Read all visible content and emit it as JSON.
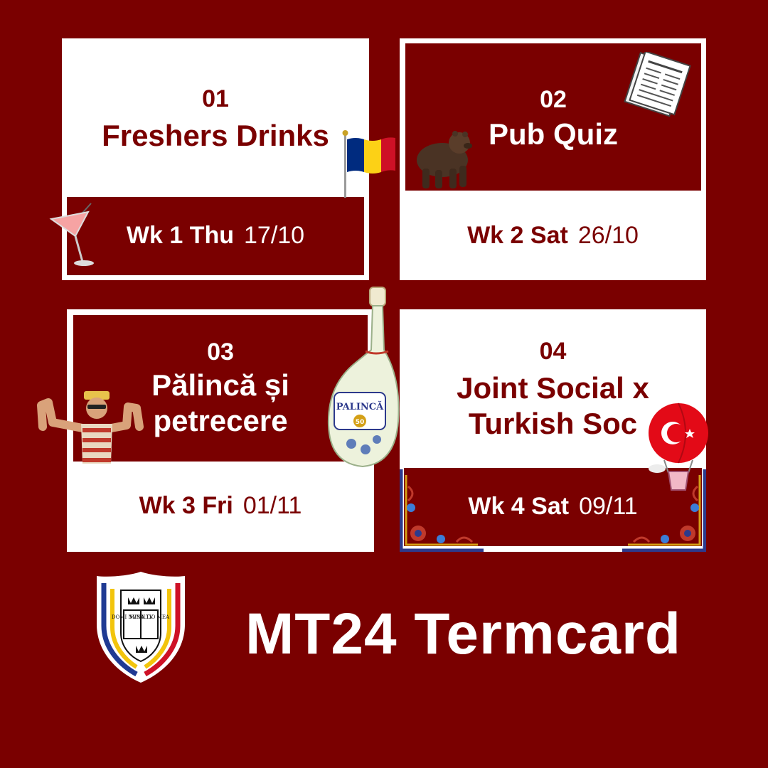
{
  "events": [
    {
      "number": "01",
      "title": "Freshers Drinks",
      "week": "Wk 1 Thu",
      "date": "17/10"
    },
    {
      "number": "02",
      "title": "Pub Quiz",
      "week": "Wk 2 Sat",
      "date": "26/10"
    },
    {
      "number": "03",
      "title_line1": "Pălincă și",
      "title_line2": "petrecere",
      "week": "Wk 3 Fri",
      "date": "01/11"
    },
    {
      "number": "04",
      "title_line1": "Joint Social x",
      "title_line2": "Turkish Soc",
      "week": "Wk 4 Sat",
      "date": "09/11"
    }
  ],
  "footer": {
    "title": "MT24 Termcard"
  },
  "crest": {
    "text_tl": "DOMI NVS ILLV",
    "text_tr": "MINA TIO MEA"
  },
  "bottle": {
    "label": "PALINCĂ",
    "badge": "50"
  },
  "icons": [
    "cocktail-icon",
    "romania-flag-icon",
    "bear-icon",
    "newspaper-icon",
    "dancer-icon",
    "palinca-bottle-icon",
    "turkey-balloon-icon",
    "oxford-crest-icon"
  ],
  "colors": {
    "background": "#7a0000",
    "card": "#ffffff",
    "romania_blue": "#002b7f",
    "romania_yellow": "#fcd116",
    "romania_red": "#ce1126",
    "turkey_red": "#e30a17"
  }
}
